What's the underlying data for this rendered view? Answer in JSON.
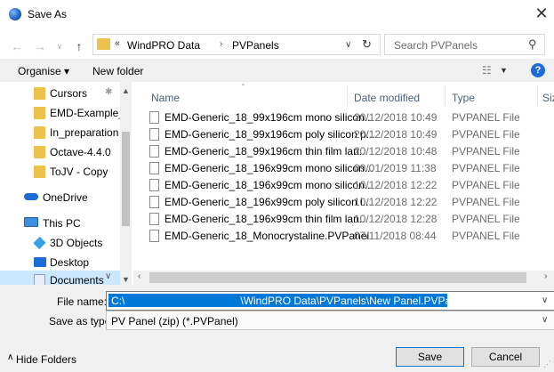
{
  "window": {
    "title": "Save As",
    "close_glyph": "✕"
  },
  "address": {
    "breadcrumb_prefix": "«",
    "crumbs": [
      "WindPRO Data",
      "PVPanels"
    ],
    "separator": "›",
    "search_placeholder": "Search PVPanels"
  },
  "toolbar": {
    "organise_label": "Organise ▾",
    "new_folder_label": "New folder",
    "help_label": "?"
  },
  "nav": {
    "items": [
      {
        "label": "Cursors",
        "icon": "folder-icon"
      },
      {
        "label": "EMD-Example_1",
        "icon": "folder-icon"
      },
      {
        "label": "In_preparation",
        "icon": "folder-icon"
      },
      {
        "label": "Octave-4.4.0",
        "icon": "folder-icon"
      },
      {
        "label": "ToJV - Copy",
        "icon": "folder-icon"
      },
      {
        "label": "OneDrive",
        "icon": "cloud-icon"
      },
      {
        "label": "This PC",
        "icon": "computer-icon"
      },
      {
        "label": "3D Objects",
        "icon": "cube-icon"
      },
      {
        "label": "Desktop",
        "icon": "desktop-icon"
      },
      {
        "label": "Documents",
        "icon": "documents-icon",
        "selected": true
      }
    ]
  },
  "filelist": {
    "columns": [
      "Name",
      "Date modified",
      "Type",
      "Siz"
    ],
    "rows": [
      {
        "name": "EMD-Generic_18_99x196cm mono silicon...",
        "date": "20/12/2018 10:49",
        "type": "PVPANEL File"
      },
      {
        "name": "EMD-Generic_18_99x196cm poly silicon p...",
        "date": "20/12/2018 10:49",
        "type": "PVPANEL File"
      },
      {
        "name": "EMD-Generic_18_99x196cm thin film lan...",
        "date": "20/12/2018 10:48",
        "type": "PVPANEL File"
      },
      {
        "name": "EMD-Generic_18_196x99cm mono silicon...",
        "date": "09/01/2019 11:38",
        "type": "PVPANEL File"
      },
      {
        "name": "EMD-Generic_18_196x99cm mono silicon...",
        "date": "10/12/2018 12:22",
        "type": "PVPANEL File"
      },
      {
        "name": "EMD-Generic_18_196x99cm poly silicon l...",
        "date": "10/12/2018 12:22",
        "type": "PVPANEL File"
      },
      {
        "name": "EMD-Generic_18_196x99cm thin film lan...",
        "date": "10/12/2018 12:28",
        "type": "PVPANEL File"
      },
      {
        "name": "EMD-Generic_18_Monocrystaline.PVPanel",
        "date": "07/11/2018 08:44",
        "type": "PVPANEL File"
      }
    ]
  },
  "form": {
    "filename_label": "File name:",
    "filename_value": "C:\\                                       \\WindPRO Data\\PVPanels\\New Panel.PVPanel",
    "savetype_label": "Save as type:",
    "savetype_value": "PV Panel (zip) (*.PVPanel)",
    "hide_folders_label": "Hide Folders",
    "save_label": "Save",
    "cancel_label": "Cancel"
  },
  "colors": {
    "accent": "#0078d7",
    "folder": "#ecc24c",
    "selection": "#cce8ff"
  }
}
